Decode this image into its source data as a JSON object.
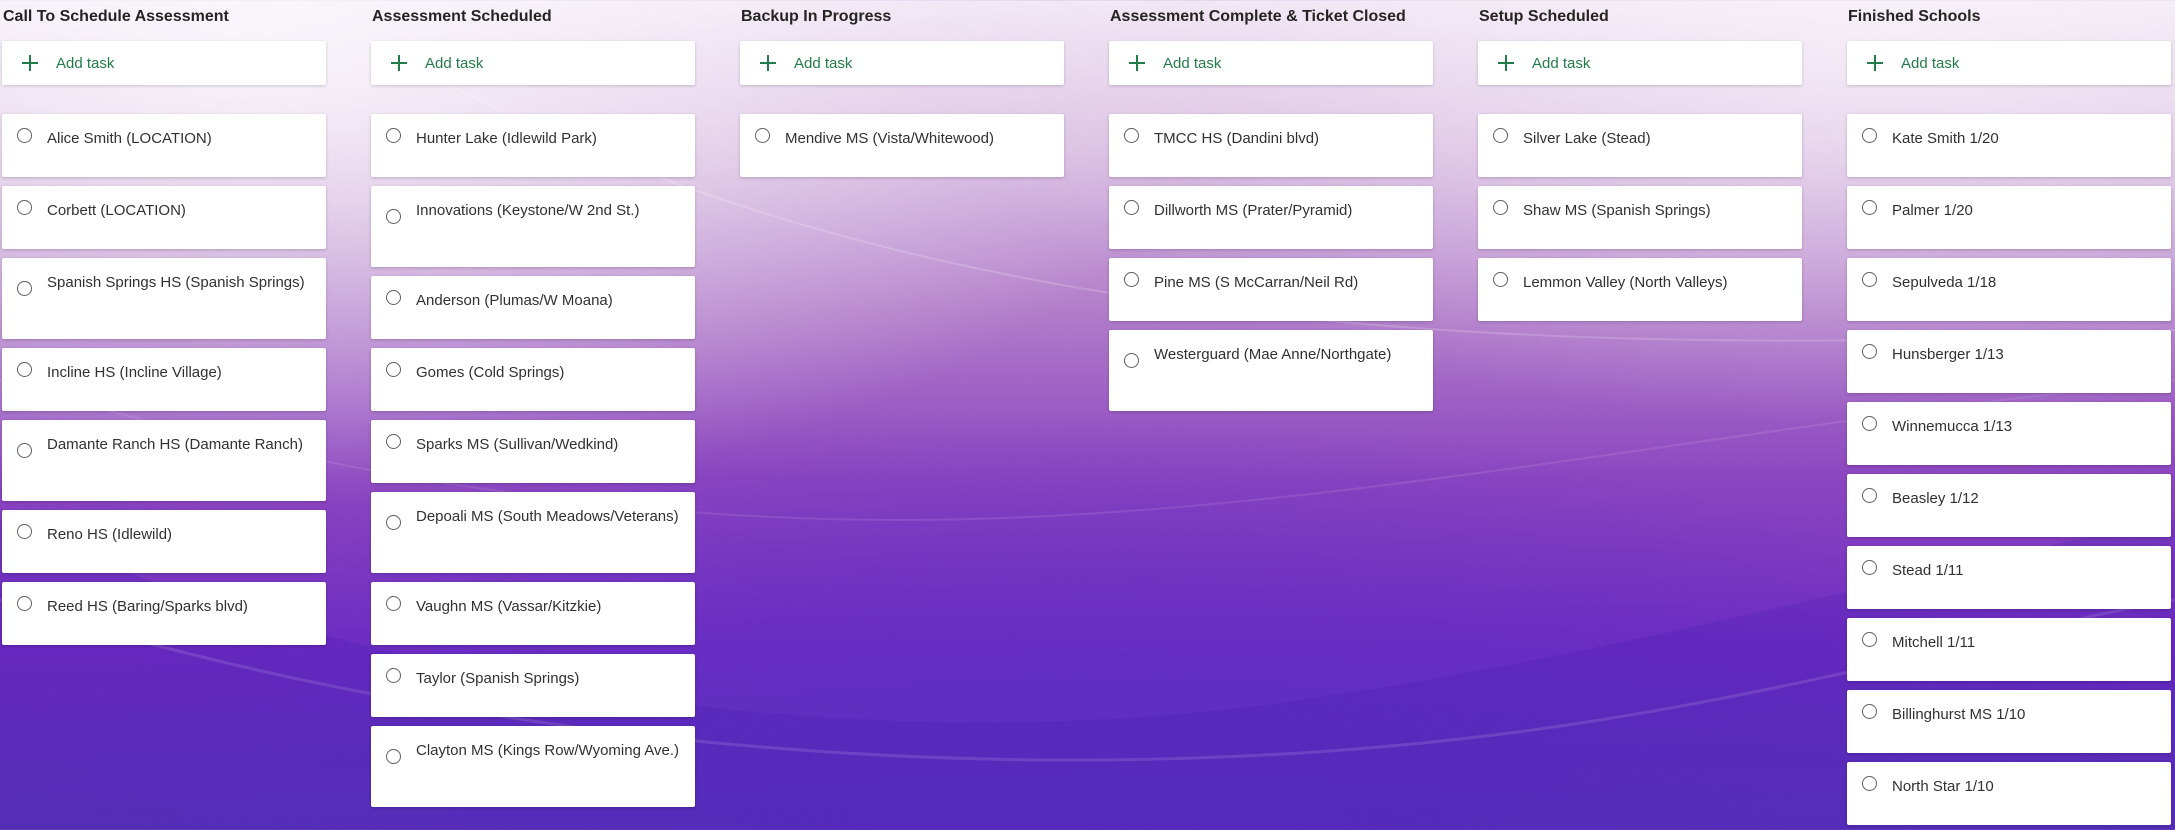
{
  "board": {
    "add_task_label": "Add task",
    "columns": [
      {
        "title": "Call To Schedule Assessment",
        "tasks": [
          "Alice Smith (LOCATION)",
          "Corbett (LOCATION)",
          "Spanish Springs HS (Spanish Springs)",
          "Incline HS (Incline Village)",
          "Damante Ranch HS (Damante Ranch)",
          "Reno HS (Idlewild)",
          "Reed HS (Baring/Sparks blvd)"
        ]
      },
      {
        "title": "Assessment Scheduled",
        "tasks": [
          "Hunter Lake (Idlewild Park)",
          "Innovations (Keystone/W 2nd St.)",
          "Anderson (Plumas/W Moana)",
          "Gomes (Cold Springs)",
          "Sparks MS (Sullivan/Wedkind)",
          "Depoali MS (South Meadows/Veterans)",
          "Vaughn MS (Vassar/Kitzkie)",
          "Taylor (Spanish Springs)",
          "Clayton MS (Kings Row/Wyoming Ave.)"
        ]
      },
      {
        "title": "Backup In Progress",
        "tasks": [
          "Mendive MS (Vista/Whitewood)"
        ]
      },
      {
        "title": "Assessment Complete & Ticket Closed",
        "tasks": [
          "TMCC HS (Dandini blvd)",
          "Dillworth MS (Prater/Pyramid)",
          "Pine MS (S McCarran/Neil Rd)",
          "Westerguard (Mae Anne/Northgate)"
        ]
      },
      {
        "title": "Setup Scheduled",
        "tasks": [
          "Silver Lake (Stead)",
          "Shaw MS (Spanish Springs)",
          "Lemmon Valley (North Valleys)"
        ]
      },
      {
        "title": "Finished Schools",
        "tasks": [
          "Kate Smith 1/20",
          "Palmer 1/20",
          "Sepulveda 1/18",
          "Hunsberger 1/13",
          "Winnemucca 1/13",
          "Beasley 1/12",
          "Stead 1/11",
          "Mitchell 1/11",
          "Billinghurst MS 1/10",
          "North Star 1/10"
        ]
      }
    ]
  }
}
